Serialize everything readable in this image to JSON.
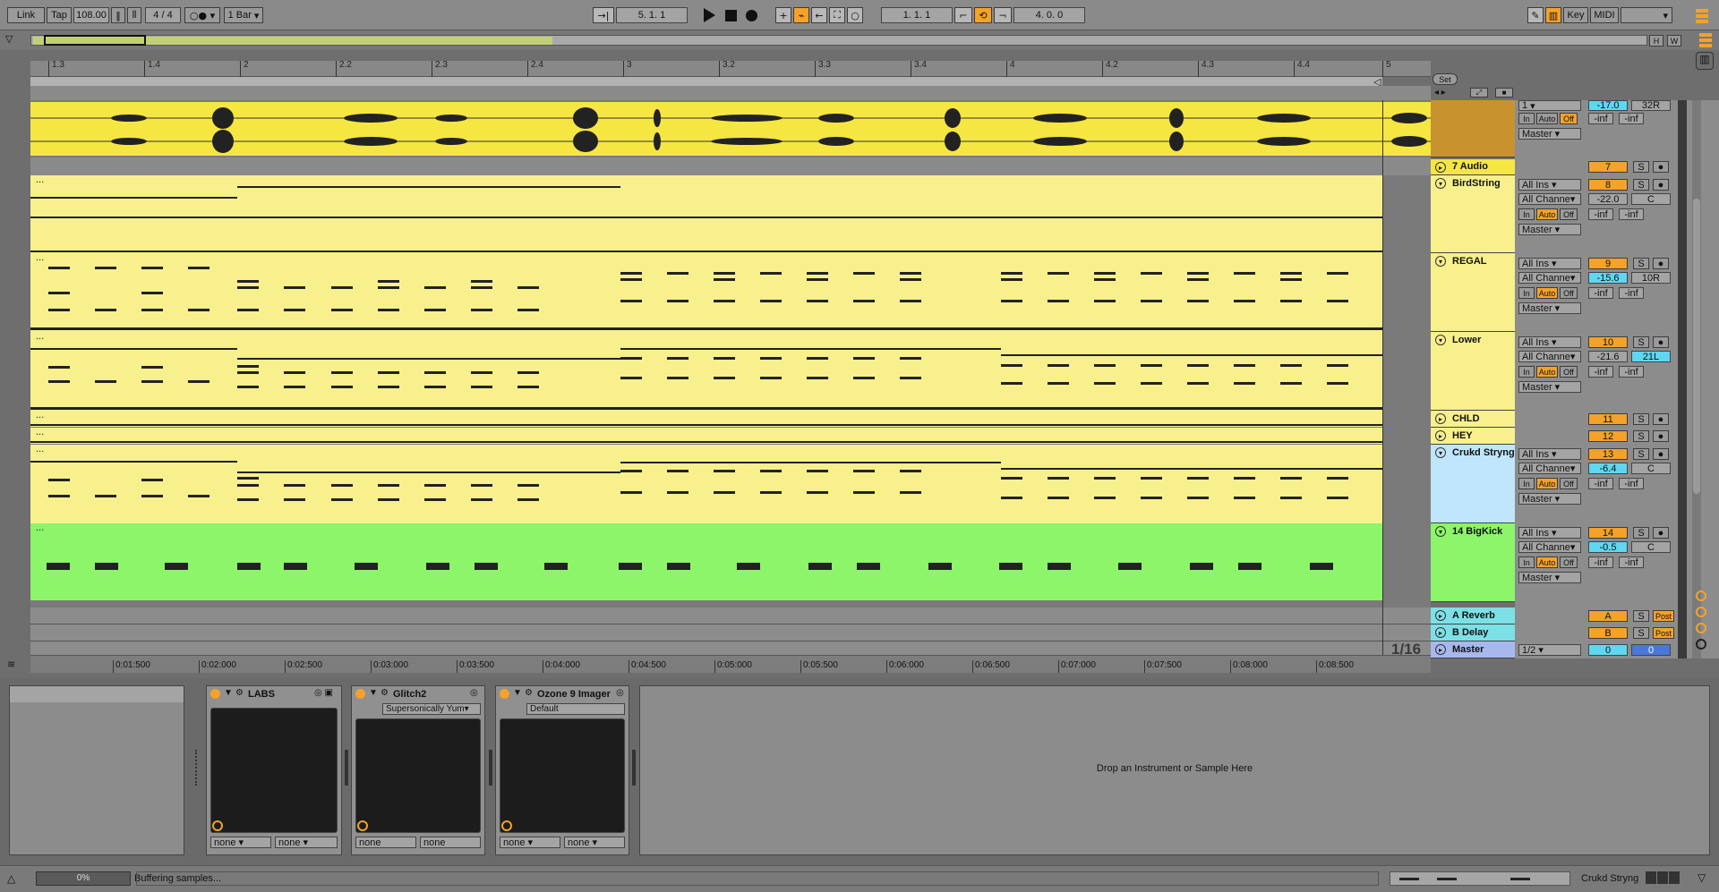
{
  "transport": {
    "link": "Link",
    "tap": "Tap",
    "tempo": "108.00",
    "signature": "4 / 4",
    "quantize": "1 Bar",
    "position": "5.   1.   1",
    "loop_start": "1.   1.   1",
    "loop_length": "4.   0.   0",
    "key": "Key",
    "midi": "MIDI"
  },
  "overview": {
    "h": "H",
    "w": "W"
  },
  "ruler": {
    "ticks": [
      "1.3",
      "1.4",
      "2",
      "2.2",
      "2.3",
      "2.4",
      "3",
      "3.2",
      "3.3",
      "3.4",
      "4",
      "4.2",
      "4.3",
      "4.4",
      "5"
    ],
    "set_label": "Set"
  },
  "time_ruler": [
    "0:01:500",
    "0:02:000",
    "0:02:500",
    "0:03:000",
    "0:03:500",
    "0:04:000",
    "0:04:500",
    "0:05:000",
    "0:05:500",
    "0:06:000",
    "0:06:500",
    "0:07:000",
    "0:07:500",
    "0:08:000",
    "0:08:500"
  ],
  "quantize_display": "1/16",
  "tracks": [
    {
      "name": "7 Audio",
      "number": "7",
      "color": "#f5e642"
    },
    {
      "name": "BirdString",
      "number": "8",
      "vol": "-22.0",
      "pan": "C",
      "color": "#f7f08c"
    },
    {
      "name": "REGAL",
      "number": "9",
      "vol": "-15.6",
      "pan": "10R",
      "color": "#f7f08c"
    },
    {
      "name": "Lower",
      "number": "10",
      "vol": "-21.6",
      "pan": "21L",
      "color": "#f7f08c"
    },
    {
      "name": "CHLD",
      "number": "11",
      "color": "#f7f08c"
    },
    {
      "name": "HEY",
      "number": "12",
      "color": "#f7f08c"
    },
    {
      "name": "Crukd Stryng",
      "number": "13",
      "vol": "-6.4",
      "pan": "C",
      "color": "#bfe6fa"
    },
    {
      "name": "14 BigKick",
      "number": "14",
      "vol": "-0.5",
      "pan": "C",
      "color": "#8cf56a"
    },
    {
      "name": "A Reverb",
      "number": "A",
      "post": "Post",
      "color": "#7de0e6"
    },
    {
      "name": "B Delay",
      "number": "B",
      "post": "Post",
      "color": "#7de0e6"
    },
    {
      "name": "Master",
      "number": "0",
      "pan": "0",
      "routing": "1/2",
      "color": "#a8b8ee"
    }
  ],
  "mixer": {
    "all_ins": "All Ins",
    "all_channels": "All Channe",
    "in": "In",
    "auto": "Auto",
    "off": "Off",
    "master": "Master",
    "inf": "-inf",
    "solo": "S",
    "top_vol": "-17.0",
    "top_pan": "32R",
    "top_routing": "1"
  },
  "devices": {
    "labs": {
      "name": "LABS",
      "chain1": "none",
      "chain2": "none"
    },
    "glitch": {
      "name": "Glitch2",
      "preset": "Supersonically Yum",
      "chain1": "none",
      "chain2": "none"
    },
    "ozone": {
      "name": "Ozone 9 Imager",
      "preset": "Default",
      "chain1": "none",
      "chain2": "none"
    },
    "drop_hint": "Drop an Instrument or Sample Here"
  },
  "status": {
    "progress_label": "0%",
    "message": "Buffering samples...",
    "selected_track": "Crukd Stryng"
  },
  "colors": {
    "accent": "#f4a229",
    "audio_clip": "#f5e642",
    "midi_clip": "#f7f08c",
    "kick_clip": "#8cf56a"
  }
}
